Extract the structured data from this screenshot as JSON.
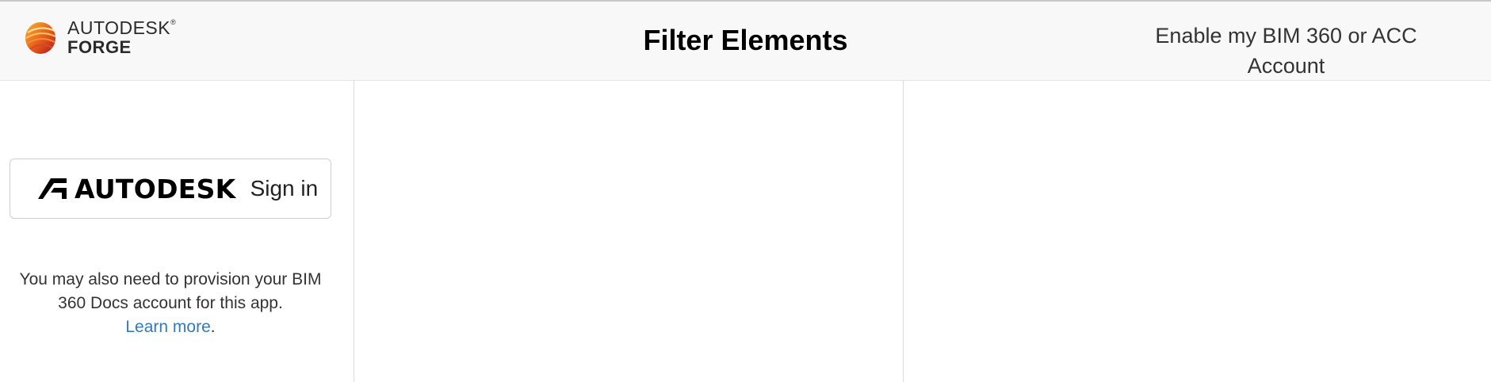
{
  "header": {
    "brand_line1": "AUTODESK",
    "brand_line2": "FORGE",
    "title": "Filter Elements",
    "enable_account_link": "Enable my BIM 360 or ACC Account"
  },
  "sidebar": {
    "signin_brand": "AUTODESK",
    "signin_label": "Sign in",
    "provision_text": "You may also need to provision your BIM 360 Docs account for this app.",
    "learn_more_label": "Learn more",
    "learn_more_suffix": "."
  },
  "colors": {
    "link": "#337ab7",
    "navbar_bg": "#f8f8f8"
  }
}
